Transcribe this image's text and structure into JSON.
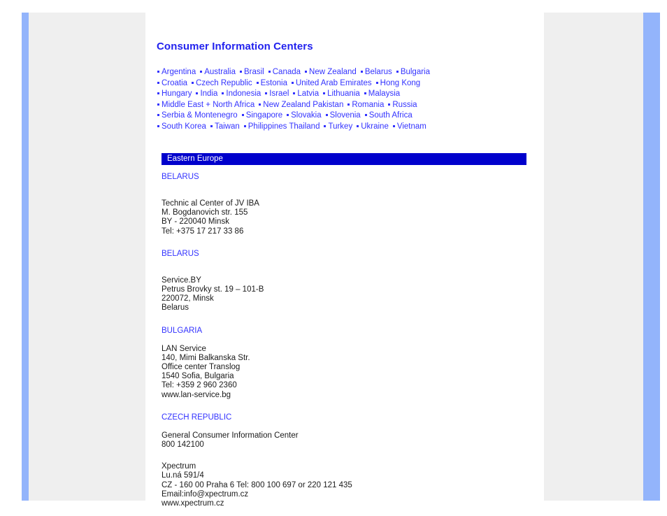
{
  "theme": {
    "edge_bar_color": "#93b4fb",
    "gutter_color": "#efefef",
    "link_color": "#3333ff",
    "title_color": "#2222ee",
    "banner_color": "#0000cc",
    "banner_text_color": "#ffffff",
    "body_text_color": "#1a1a1a"
  },
  "page": {
    "title": "Consumer Information Centers"
  },
  "country_links": {
    "rows": [
      [
        "Argentina",
        "Australia",
        "Brasil",
        "Canada",
        "New Zealand",
        "Belarus",
        "Bulgaria"
      ],
      [
        "Croatia",
        "Czech Republic",
        "Estonia",
        "United Arab Emirates",
        "Hong Kong"
      ],
      [
        "Hungary",
        "India",
        "Indonesia",
        "Israel",
        "Latvia",
        "Lithuania",
        "Malaysia"
      ],
      [
        "Middle East + North Africa",
        "New Zealand Pakistan",
        "Romania",
        "Russia"
      ],
      [
        "Serbia & Montenegro",
        "Singapore",
        "Slovakia",
        "Slovenia",
        "South Africa"
      ],
      [
        "South Korea",
        "Taiwan",
        "Philippines  Thailand",
        "Turkey",
        "Ukraine",
        "Vietnam"
      ]
    ]
  },
  "region": {
    "label": "Eastern Europe"
  },
  "entries": [
    {
      "heading": "BELARUS",
      "body": "Technic al Center of JV IBA\nM. Bogdanovich str. 155\nBY - 220040 Minsk\nTel: +375 17 217 33 86"
    },
    {
      "heading": "BELARUS",
      "body": "Service.BY\nPetrus Brovky st. 19 – 101-B\n220072, Minsk\nBelarus"
    },
    {
      "heading": "BULGARIA",
      "body": "LAN Service\n140, Mimi Balkanska Str.\nOffice center Translog\n1540 Sofia, Bulgaria\nTel: +359 2 960 2360\nwww.lan-service.bg"
    },
    {
      "heading": "CZECH REPUBLIC",
      "body": "General Consumer Information Center\n800 142100"
    },
    {
      "heading": "",
      "body": "Xpectrum\nLu.ná 591/4\nCZ - 160 00 Praha 6 Tel: 800 100 697 or 220 121 435\nEmail:info@xpectrum.cz\nwww.xpectrum.cz"
    }
  ]
}
